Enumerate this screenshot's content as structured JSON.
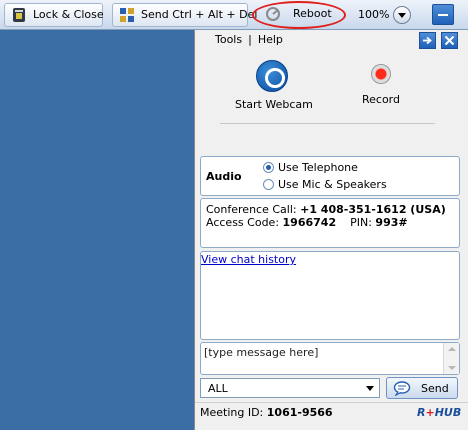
{
  "toolbar": {
    "lock_label": "Lock & Close",
    "cad_label": "Send Ctrl + Alt + Del",
    "reboot_label": "Reboot",
    "zoom": "100%",
    "icons": {
      "lock": "lock-icon",
      "cad": "keyboard-icon",
      "reboot": "reboot-icon",
      "zoom_dropdown": "chevron-down-icon",
      "minimize": "minimize-icon"
    },
    "highlight_color": "#e0201c"
  },
  "panel": {
    "menu": {
      "tools": "Tools",
      "separator": "|",
      "help": "Help"
    },
    "window_buttons": [
      "popout-icon",
      "close-icon"
    ],
    "features": {
      "webcam_label": "Start Webcam",
      "record_label": "Record"
    },
    "audio": {
      "label": "Audio",
      "options": [
        "Use Telephone",
        "Use Mic & Speakers"
      ],
      "selected": "Use Telephone"
    },
    "conference": {
      "call_label": "Conference Call:",
      "call_number": "+1 408-351-1612 (USA)",
      "access_label": "Access Code:",
      "access_code": "1966742",
      "pin_label": "PIN:",
      "pin": "993#"
    },
    "chat": {
      "history_link": "View chat history",
      "message_placeholder": "[type message here]"
    },
    "recipient": {
      "selected": "ALL"
    },
    "send_label": "Send",
    "meeting": {
      "label": "Meeting ID:",
      "id": "1061-9566"
    },
    "logo": {
      "text_left": "R",
      "text_plus": "+",
      "text_right": "HUB"
    },
    "colors": {
      "accent": "#1e60b8",
      "link": "#0000cc",
      "logo": "#1a4e9b"
    }
  }
}
